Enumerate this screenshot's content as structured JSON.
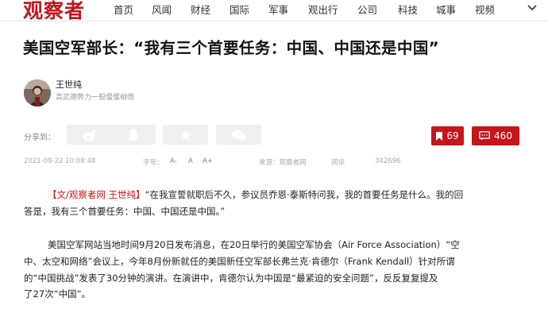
{
  "site": {
    "logo": "观察者",
    "nav": [
      "首页",
      "风闻",
      "财经",
      "国际",
      "军事",
      "观出行",
      "公司",
      "科技",
      "城事",
      "视频"
    ]
  },
  "article": {
    "title": "美国空军部长：“我有三个首要任务：中国、中国还是中国”",
    "author": {
      "name": "王世纯",
      "bio": "高武德势力一般偃偃相借"
    },
    "share_label": "分享到：",
    "share_icons": [
      "weibo-icon",
      "qq-icon",
      "qzone-star-icon",
      "wechat-icon"
    ],
    "stats": {
      "bookmarks": "69",
      "comments": "460"
    },
    "meta": {
      "datetime": "2021-09-22 10:08:48",
      "font_size_label": "字号：",
      "font_sizes": [
        "A-",
        "A",
        "A+"
      ],
      "source": "来源：观察者网",
      "views_label": "阅读",
      "views": "342696"
    },
    "paragraphs": [
      {
        "source_tag": "【文/观察者网 王世纯】",
        "lines": [
          "“在我宣誓就职后不久，参议员乔恩·泰斯特问我，我的首要任务是什么。我的回",
          "答是，我有三个首要任务：中国、中国还是中国。”"
        ]
      },
      {
        "lines": [
          "美国空军网站当地时间9月20日发布消息，在20日举行的美国空军协会（Air Force Association）“空",
          "中、太空和网络”会议上，今年8月份新就任的美国新任空军部长弗兰克·肯德尔（Frank Kendall）针对所谓",
          "的“中国挑战”发表了30分钟的演讲。在演讲中，肯德尔认为中国是“最紧迫的安全问题”，反反复复提及",
          "了27次“中国”。"
        ]
      }
    ]
  },
  "colors": {
    "brand_red": "#c4161c",
    "share_bg": "#f0f0f0"
  }
}
